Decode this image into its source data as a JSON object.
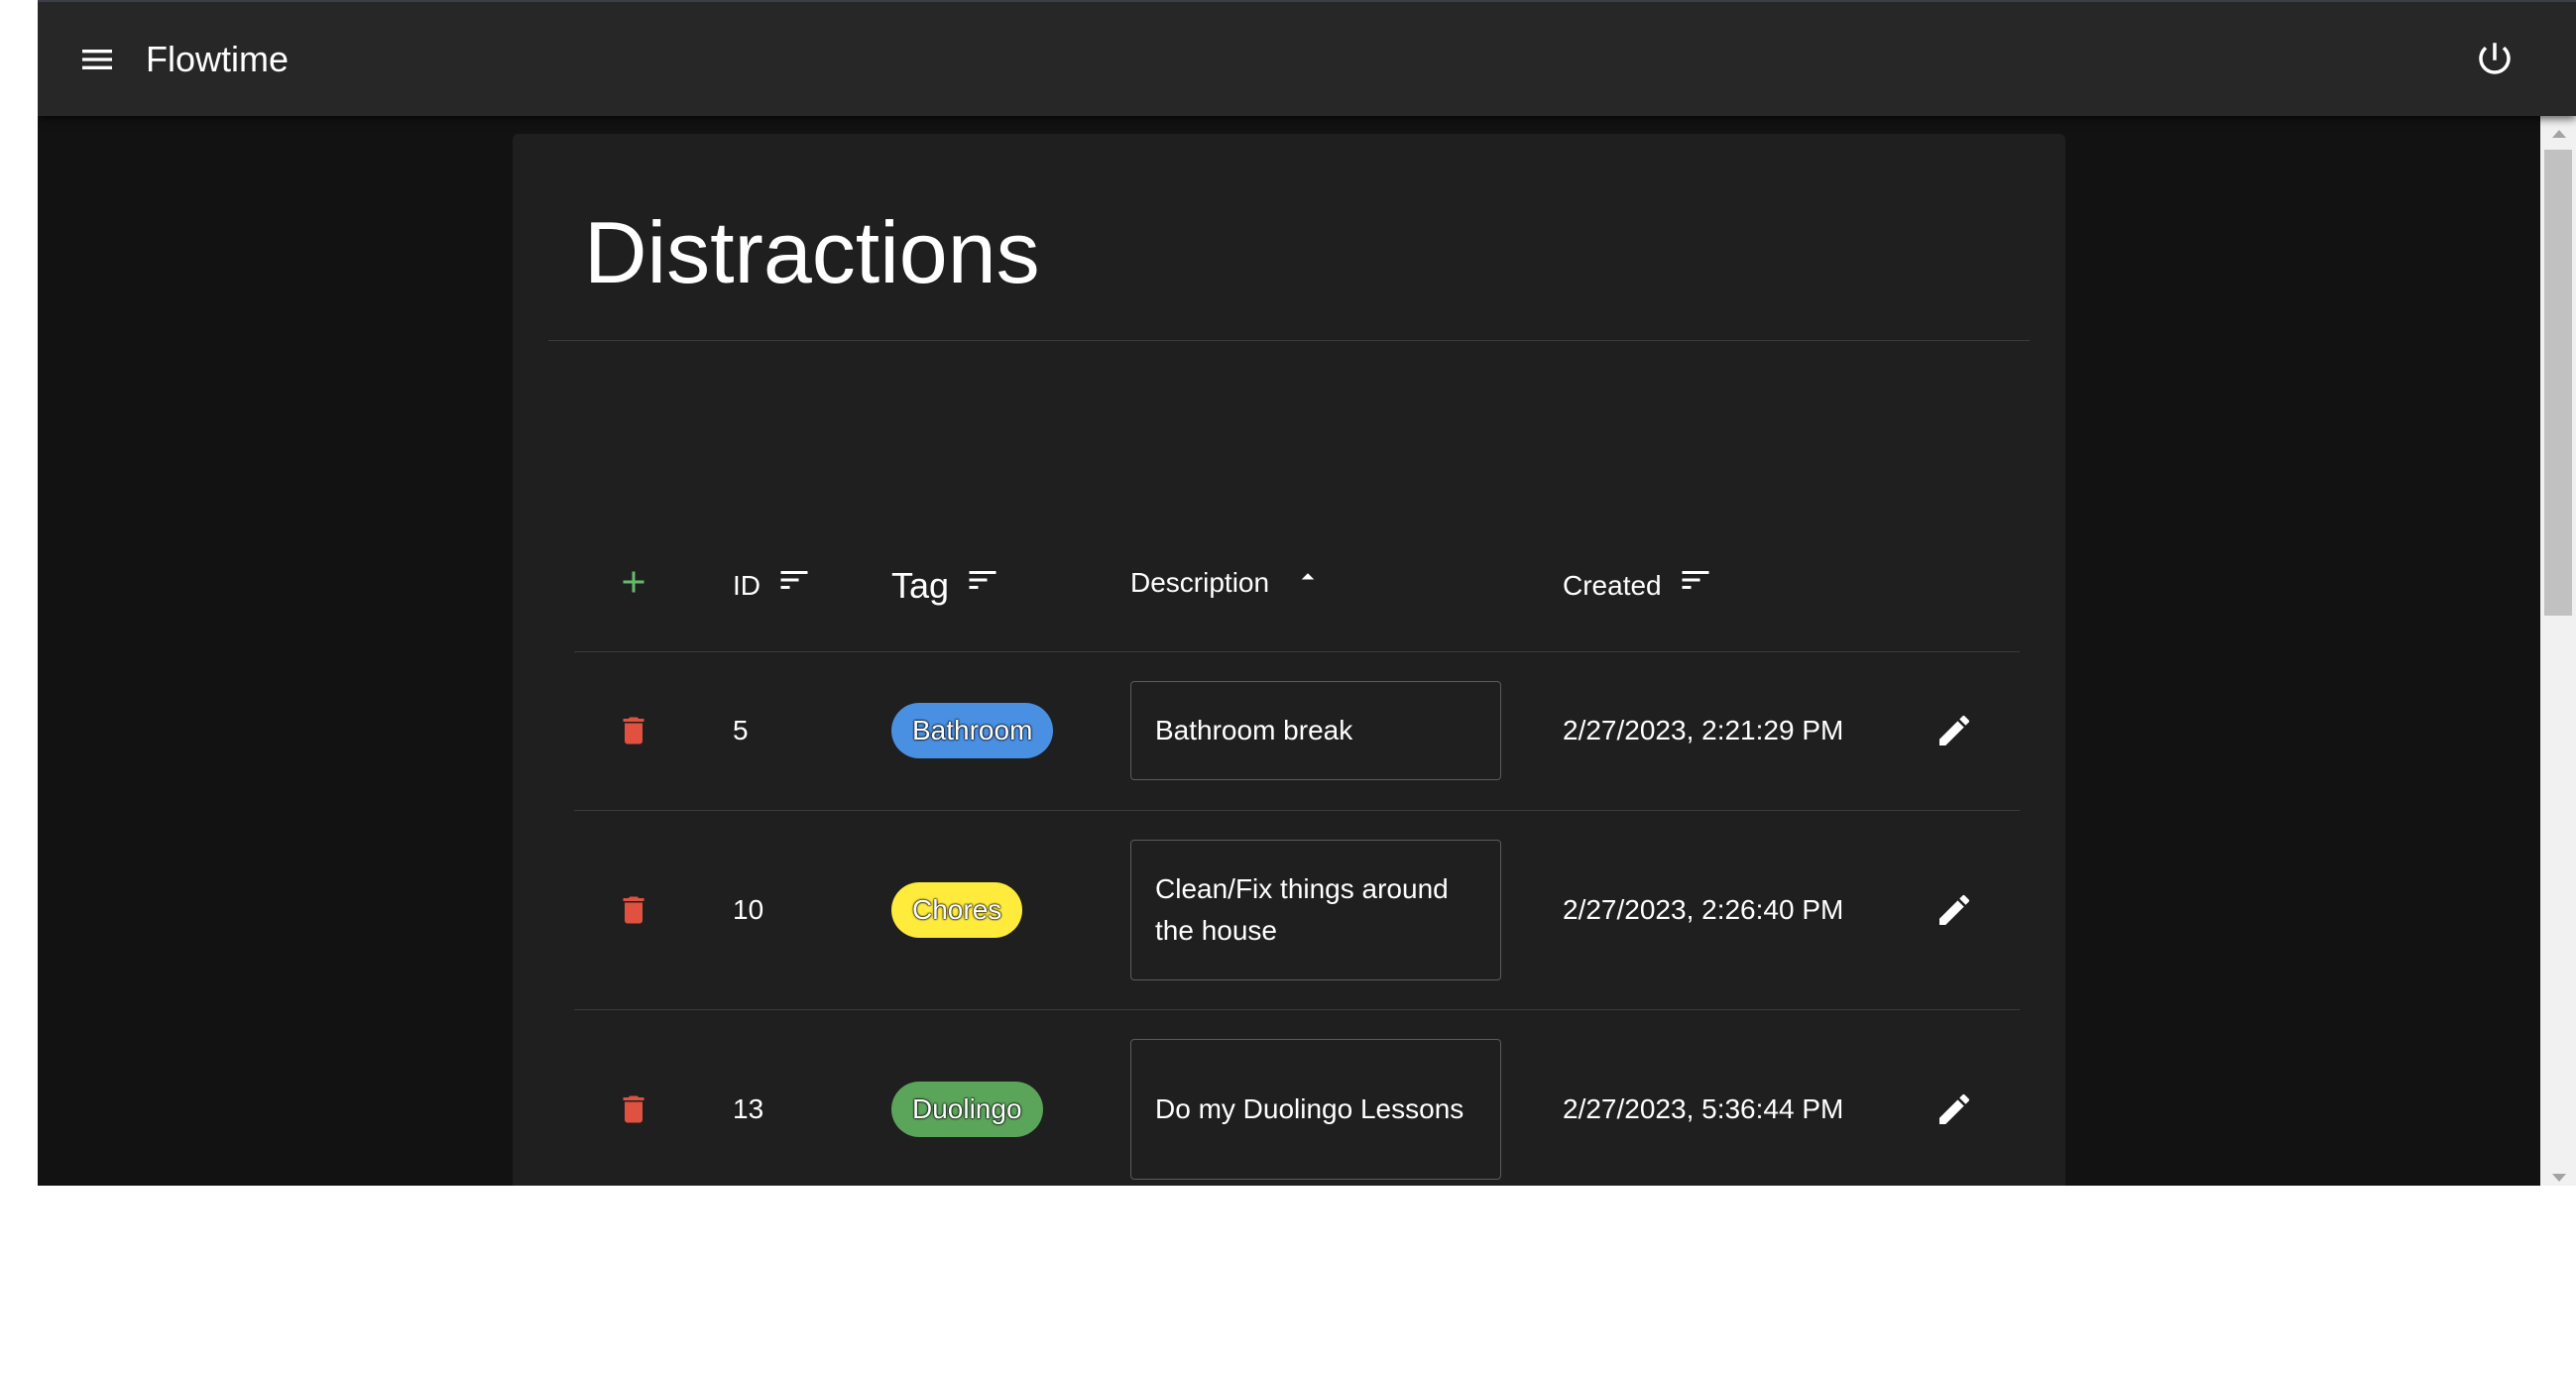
{
  "app": {
    "title": "Flowtime",
    "icons": {
      "menu": "hamburger-menu-icon",
      "power": "power-icon"
    }
  },
  "page": {
    "title": "Distractions"
  },
  "table": {
    "columns": {
      "id": {
        "label": "ID",
        "icon": "sort-icon"
      },
      "tag": {
        "label": "Tag",
        "icon": "sort-icon"
      },
      "description": {
        "label": "Description",
        "icon": "sort-ascending-arrow-icon"
      },
      "created": {
        "label": "Created",
        "icon": "sort-icon"
      }
    },
    "actions": {
      "add_icon": "plus-icon",
      "delete_icon": "trash-icon",
      "edit_icon": "pencil-icon"
    },
    "rows": [
      {
        "id": "5",
        "tag": "Bathroom",
        "tag_color": "#4a90e2",
        "description": "Bathroom break",
        "created": "2/27/2023, 2:21:29 PM"
      },
      {
        "id": "10",
        "tag": "Chores",
        "tag_color": "#ffeb3b",
        "description": "Clean/Fix things around the house",
        "created": "2/27/2023, 2:26:40 PM"
      },
      {
        "id": "13",
        "tag": "Duolingo",
        "tag_color": "#5aa55a",
        "description": "Do my Duolingo Lessons",
        "created": "2/27/2023, 5:36:44 PM"
      }
    ]
  },
  "colors": {
    "appbar": "#272727",
    "background": "#121212",
    "card": "#1f1f1f",
    "add": "#66bb6a",
    "delete": "#e0513f"
  }
}
